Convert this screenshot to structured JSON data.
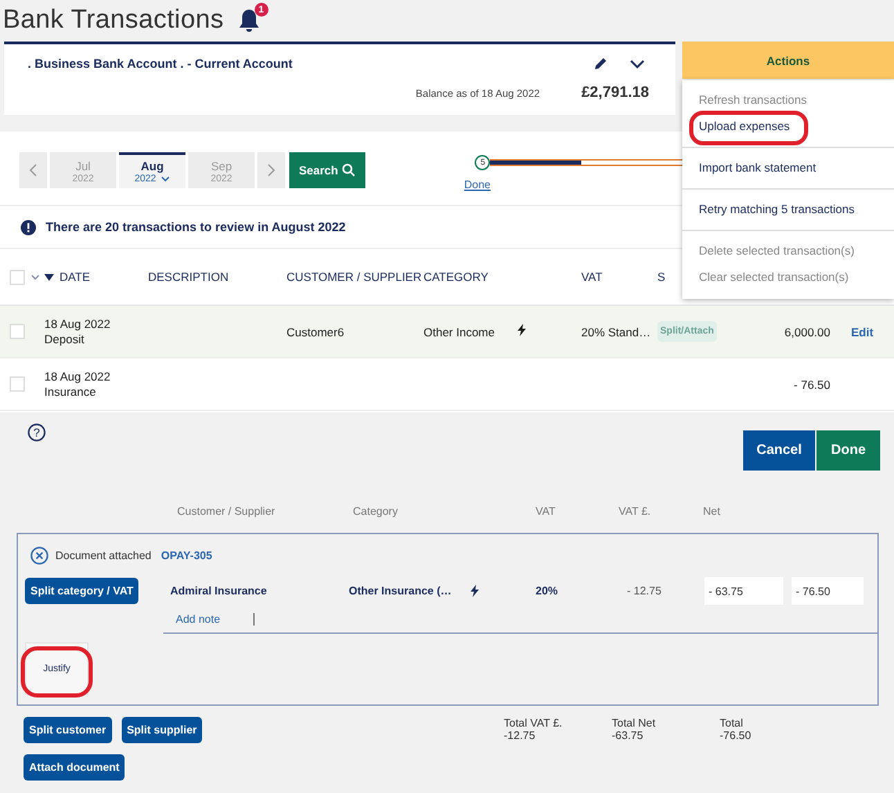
{
  "title": "Bank Transactions",
  "notifications": {
    "count": "1"
  },
  "account": {
    "name": ". Business Bank Account . - Current Account",
    "balance_label": "Balance as of 18 Aug 2022",
    "balance": "£2,791.18"
  },
  "actions": {
    "label": "Actions",
    "groups": [
      [
        {
          "label": "Refresh transactions",
          "disabled": true,
          "circled": false
        },
        {
          "label": "Upload expenses",
          "disabled": false,
          "circled": true
        }
      ],
      [
        {
          "label": "Import bank statement",
          "disabled": false,
          "circled": false
        }
      ],
      [
        {
          "label": "Retry matching 5 transactions",
          "disabled": false,
          "circled": false
        }
      ],
      [
        {
          "label": "Delete selected transaction(s)",
          "disabled": true,
          "circled": false
        },
        {
          "label": "Clear selected transaction(s)",
          "disabled": true,
          "circled": false
        }
      ]
    ]
  },
  "months": [
    {
      "month": "Jul",
      "year": "2022",
      "selected": false
    },
    {
      "month": "Aug",
      "year": "2022",
      "selected": true
    },
    {
      "month": "Sep",
      "year": "2022",
      "selected": false
    }
  ],
  "search_button": "Search",
  "progress": {
    "step": "5",
    "link": "Done",
    "level": 0.45
  },
  "notice": "There are 20 transactions to review in August 2022",
  "table": {
    "select_all": {
      "checked": false
    },
    "columns": [
      "DATE",
      "DESCRIPTION",
      "CUSTOMER / SUPPLIER",
      "CATEGORY",
      "VAT",
      "S"
    ],
    "rows": [
      {
        "date": "18 Aug 2022",
        "type": "Deposit",
        "customer": "Customer6",
        "category": "Other Income",
        "vat": "20% Stand…",
        "split": {
          "label": "Split/Attach",
          "disabled": true
        },
        "amount": "6,000.00",
        "action": "Edit",
        "highlighted": true,
        "checked": false
      },
      {
        "date": "18 Aug 2022",
        "type": "Insurance",
        "amount": "- 76.50",
        "highlighted": false,
        "checked": false
      }
    ]
  },
  "editor": {
    "help": "?",
    "cancel": "Cancel",
    "done": "Done",
    "columns": [
      "Customer / Supplier",
      "Category",
      "VAT",
      "VAT £.",
      "Net"
    ],
    "document_label": "Document attached",
    "document_ref": "OPAY-305",
    "split_button": "Split category / VAT",
    "line": {
      "supplier": "Admiral Insurance",
      "category": "Other Insurance (…",
      "vat": "20%",
      "vat_amount": "- 12.75",
      "net": "- 63.75",
      "total": "- 76.50"
    },
    "add_note": "Add note",
    "justify": {
      "label": "Justify",
      "circled": true
    },
    "buttons": [
      "Split customer",
      "Split supplier",
      "Attach document"
    ],
    "totals": [
      {
        "label": "Total VAT £.",
        "value": "-12.75"
      },
      {
        "label": "Total Net",
        "value": "-63.75"
      },
      {
        "label": "Total",
        "value": "-76.50"
      }
    ]
  }
}
